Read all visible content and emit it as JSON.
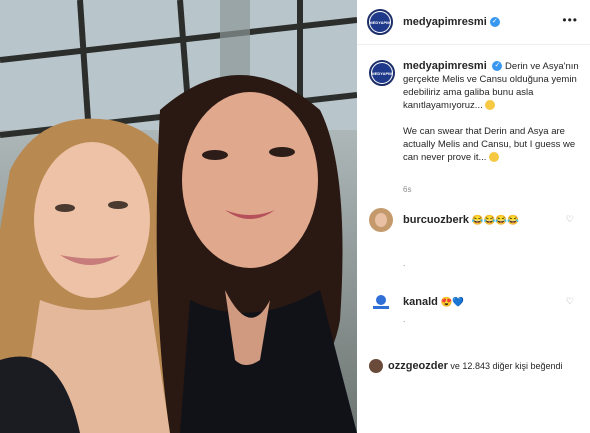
{
  "post": {
    "account": "medyapimresmi",
    "avatar_text": "MEDYAPIM",
    "more": "•••",
    "caption_tr": "Derin ve Asya'nın gerçekte Melis ve Cansu olduğuna yemin edebiliriz ama galiba bunu asla kanıtlayamıyoruz...",
    "caption_en": "We can swear that Derin and Asya are actually Melis and Cansu, but I guess we can never prove it...",
    "time": "6s"
  },
  "comments": [
    {
      "user": "burcuozberk",
      "text": "😂😂😂😂",
      "dot": "."
    },
    {
      "user": "kanald",
      "text": "😍💙",
      "dot": "."
    }
  ],
  "likes": {
    "user": "ozzgeozder",
    "text": "ve 12.843 diğer kişi beğendi"
  },
  "colors": {
    "verified": "#3897f0",
    "brand": "#1f3a8a"
  }
}
